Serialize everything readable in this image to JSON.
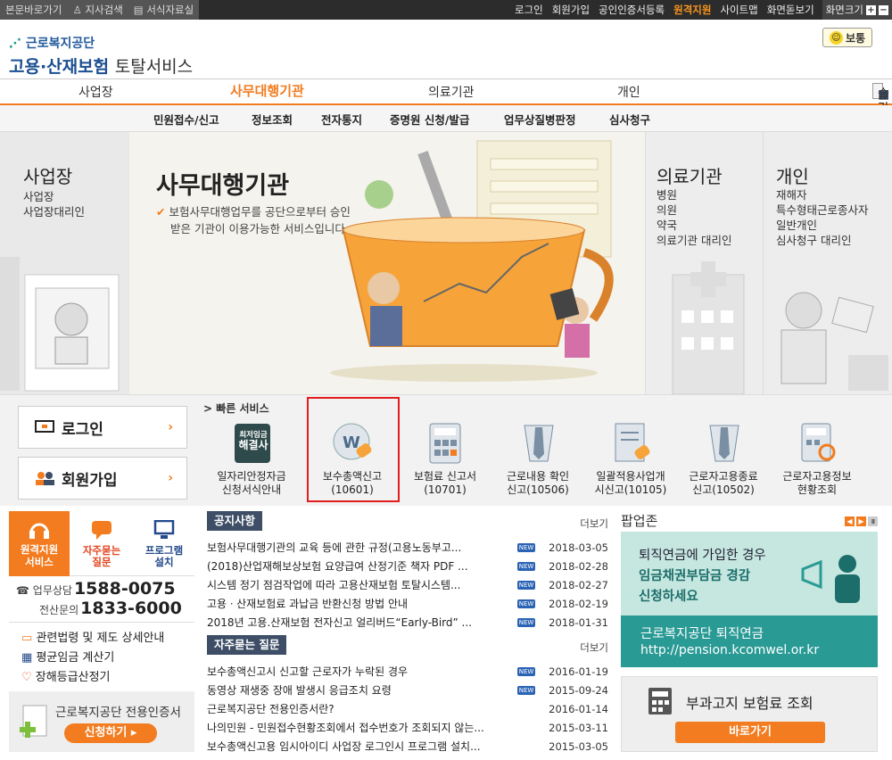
{
  "topbar": {
    "left": [
      "본문바로가기",
      "지사검색",
      "서식자료실"
    ],
    "right": [
      "로그인",
      "회원가입",
      "공인인증서등록",
      "원격지원",
      "사이트맵",
      "화면돋보기"
    ],
    "font_size_label": "화면크기"
  },
  "logo": {
    "org": "근로복지공단",
    "name_main": "고용·산재보험",
    "name_sub": "토탈서비스"
  },
  "weather_badge": "보통",
  "gnb": {
    "items": [
      "사업장",
      "사무대행기관",
      "의료기관",
      "개인"
    ],
    "active": "사무대행기관",
    "slide_stop": "슬라이드 정지"
  },
  "subnav": [
    "민원접수/신고",
    "정보조회",
    "전자통지",
    "증명원 신청/발급",
    "업무상질병판정",
    "심사청구"
  ],
  "stage": {
    "left": {
      "title": "사업장",
      "lines": [
        "사업장",
        "사업장대리인"
      ]
    },
    "center": {
      "title": "사무대행기관",
      "desc1": "보험사무대행업무를 공단으로부터 승인",
      "desc2": "받은 기관이 이용가능한 서비스입니다."
    },
    "medical": {
      "title": "의료기관",
      "lines": [
        "병원",
        "의원",
        "약국",
        "의료기관 대리인"
      ]
    },
    "personal": {
      "title": "개인",
      "lines": [
        "재해자",
        "특수형태근로종사자",
        "일반개인",
        "심사청구 대리인"
      ]
    }
  },
  "quick": {
    "login": "로그인",
    "join": "회원가입",
    "header": "> 빠른 서비스",
    "items": [
      {
        "l1": "일자리안정자금",
        "l2": "신청서식안내",
        "badge1": "최저임금",
        "badge2": "해결사"
      },
      {
        "l1": "보수총액신고",
        "l2": "(10601)"
      },
      {
        "l1": "보험료 신고서",
        "l2": "(10701)"
      },
      {
        "l1": "근로내용 확인",
        "l2": "신고(10506)"
      },
      {
        "l1": "일괄적용사업개",
        "l2": "시신고(10105)"
      },
      {
        "l1": "근로자고용종료",
        "l2": "신고(10502)"
      },
      {
        "l1": "근로자고용정보",
        "l2": "현황조회"
      }
    ]
  },
  "leftbox": {
    "remote": [
      "원격지원",
      "서비스"
    ],
    "faq": [
      "자주묻는",
      "질문"
    ],
    "program": [
      "프로그램",
      "설치"
    ],
    "tel1_label": "업무상담",
    "tel1": "1588-0075",
    "tel2_label": "전산문의",
    "tel2": "1833-6000",
    "links": [
      "관련법령 및 제도 상세안내",
      "평균임금 계산기",
      "장해등급산정기"
    ],
    "cert_title": "근로복지공단 전용인증서",
    "cert_btn": "신청하기"
  },
  "notice": {
    "title": "공지사항",
    "more": "더보기",
    "new_label": "NEW",
    "rows": [
      {
        "text": "보험사무대행기관의 교육 등에 관한 규정(고용노동부고...",
        "date": "2018-03-05",
        "new": true
      },
      {
        "text": "(2018)산업재해보상보험 요양급여 산정기준 책자 PDF ...",
        "date": "2018-02-28",
        "new": true
      },
      {
        "text": "시스템 정기 점검작업에 따라 고용산재보험 토탈시스템...",
        "date": "2018-02-27",
        "new": true
      },
      {
        "text": "고용ㆍ산재보험료 과납금 반환신청 방법 안내",
        "date": "2018-02-19",
        "new": true
      },
      {
        "text": "2018년 고용.산재보험 전자신고 얼리버드“Early-Bird” ...",
        "date": "2018-01-31",
        "new": true
      }
    ]
  },
  "faqboard": {
    "title": "자주묻는 질문",
    "more": "더보기",
    "new_label": "NEW",
    "rows": [
      {
        "text": "보수총액신고시 신고할 근로자가 누락된 경우",
        "date": "2016-01-19",
        "new": true
      },
      {
        "text": "동영상 재생중 장애 발생시 응급조치 요령",
        "date": "2015-09-24",
        "new": true
      },
      {
        "text": "근로복지공단 전용인증서란?",
        "date": "2016-01-14",
        "new": false
      },
      {
        "text": "나의민원 - 민원접수현황조회에서 접수번호가 조회되지 않는...",
        "date": "2015-03-11",
        "new": false
      },
      {
        "text": "보수총액신고용 임시아이디 사업장 로그인시 프로그램 설치...",
        "date": "2015-03-05",
        "new": false
      }
    ]
  },
  "popup": {
    "title": "팝업존",
    "b1_line1": "퇴직연금에 가입한 경우",
    "b1_line2": "임금채권부담금 경감",
    "b1_line3": "신청하세요",
    "b2_line1": "근로복지공단 퇴직연금",
    "b2_line2": "http://pension.kcomwel.or.kr",
    "b3_title": "부과고지 보험료 조회",
    "b3_btn": "바로가기"
  },
  "colors": {
    "accent": "#f27c1f",
    "navy": "#3d4e66",
    "teal": "#2a9a95",
    "highlight": "#e21d1d"
  }
}
